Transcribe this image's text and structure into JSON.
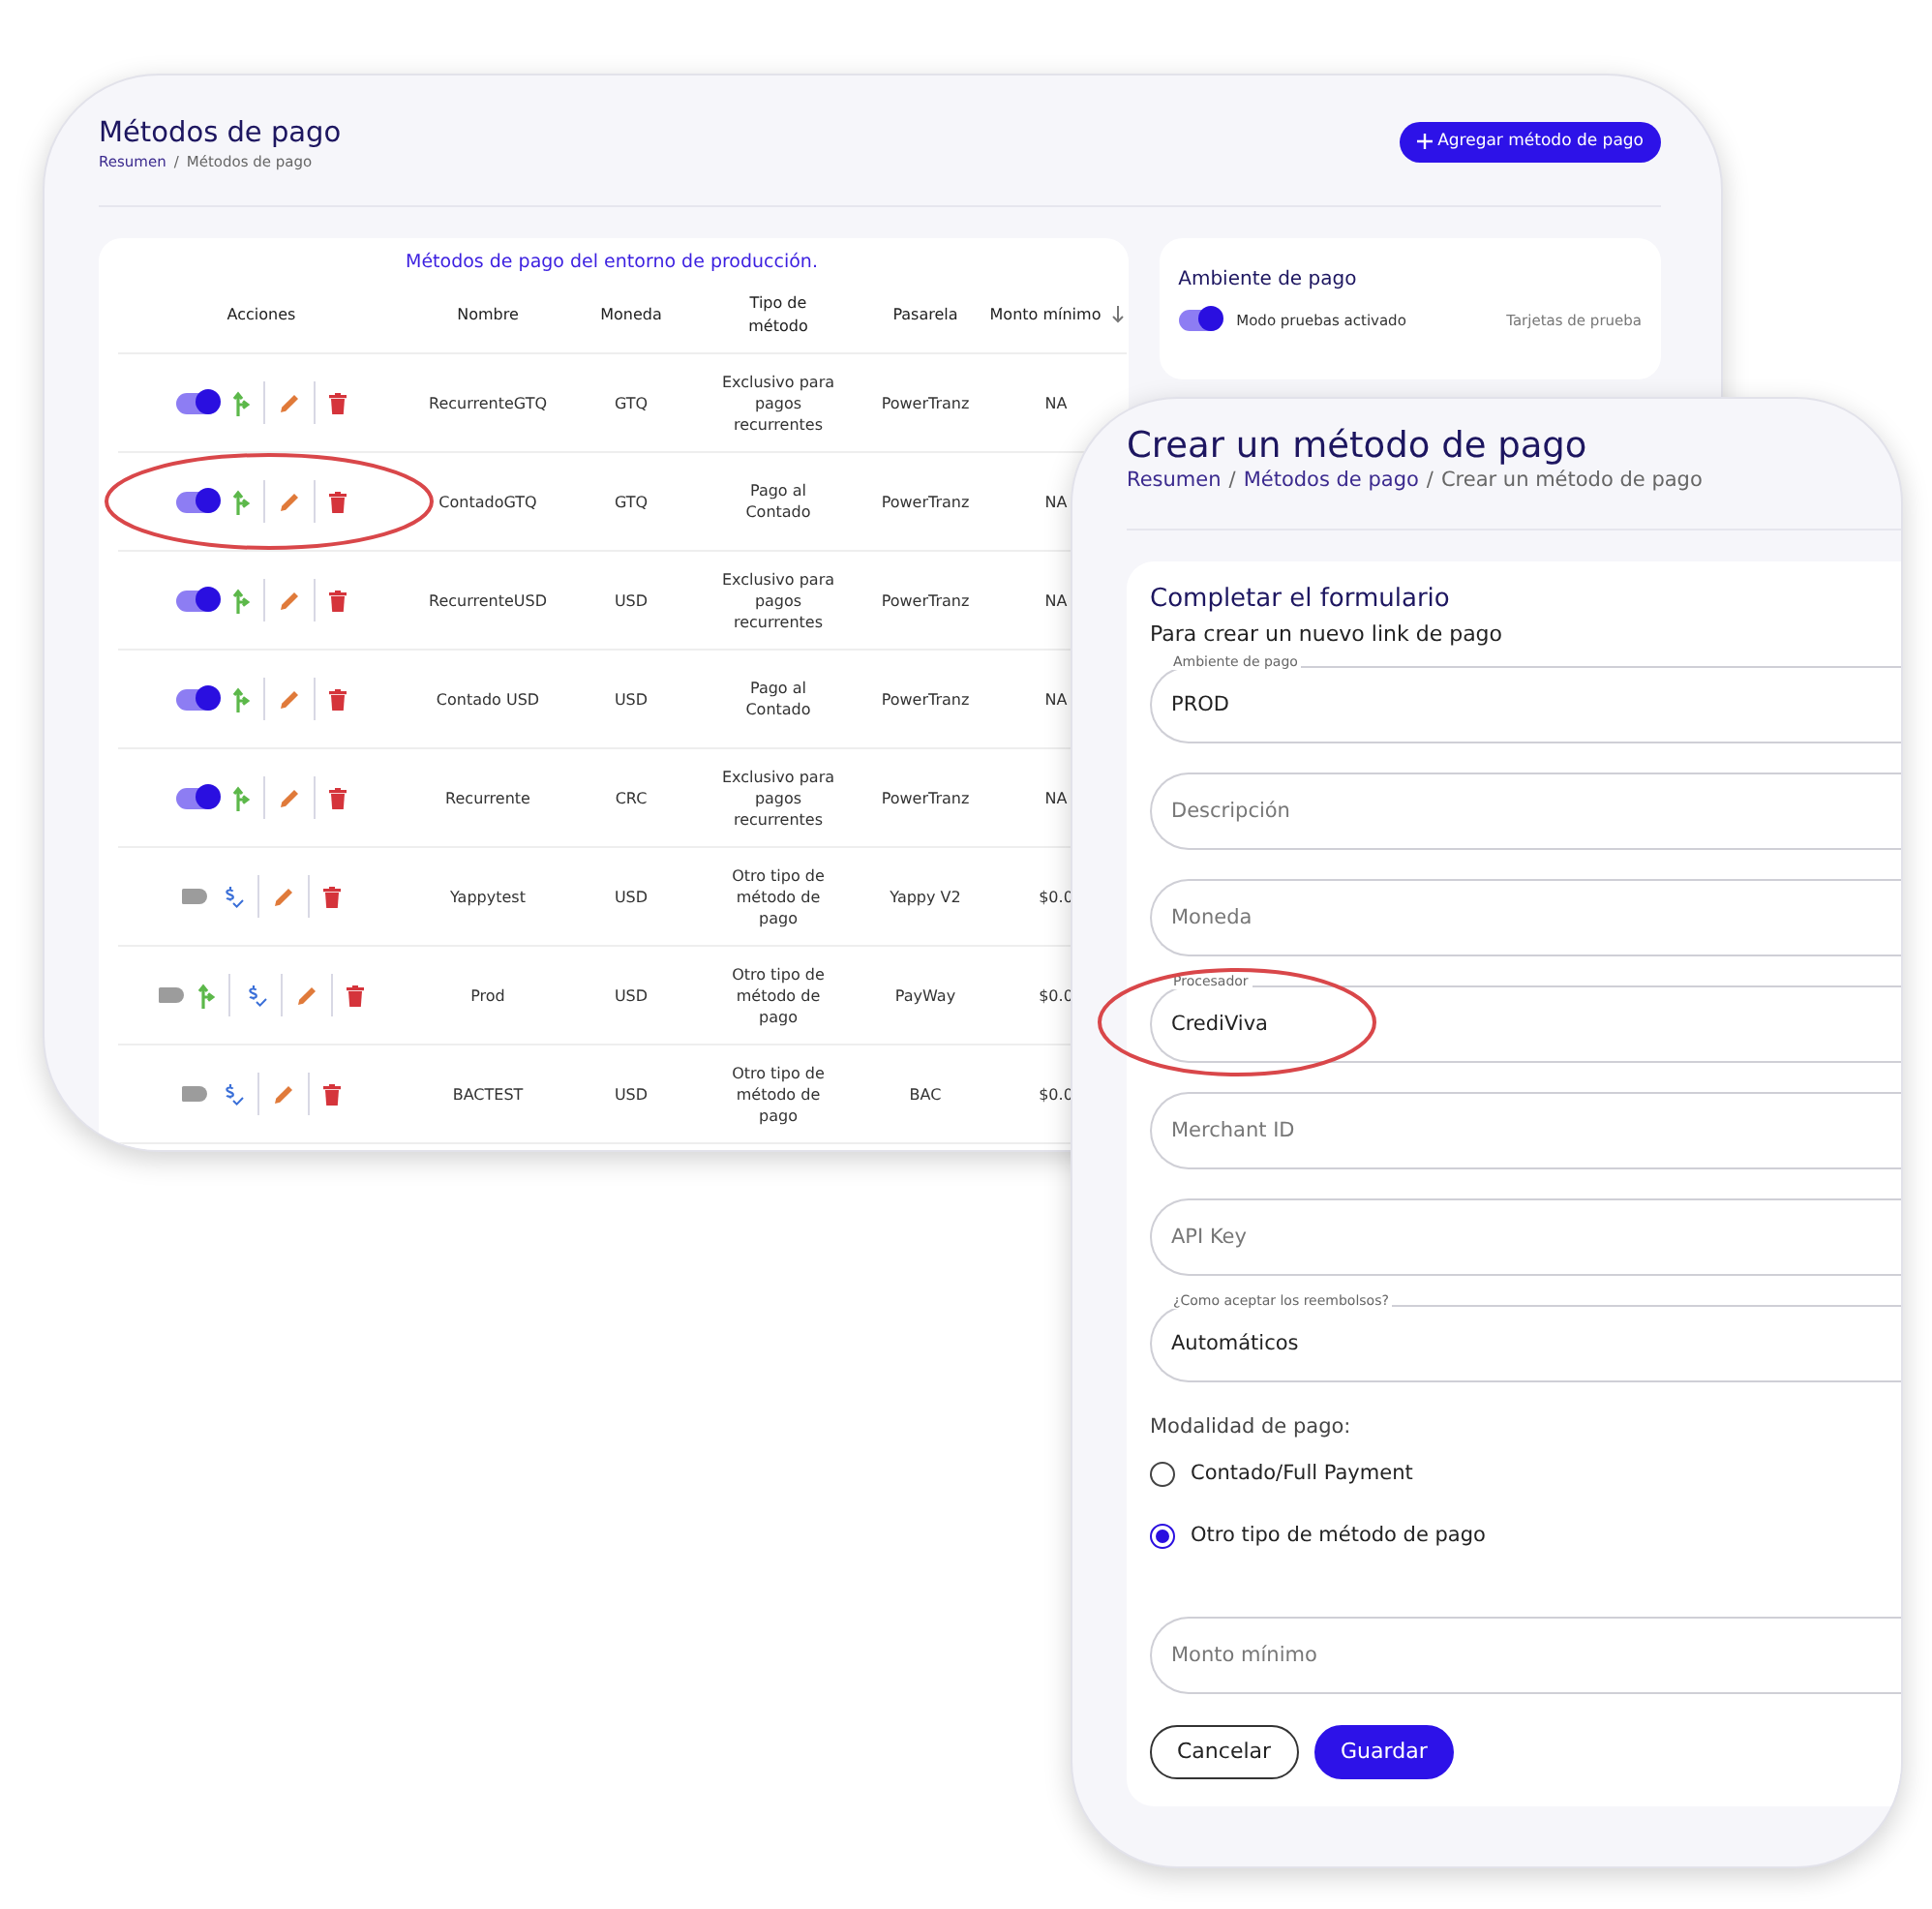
{
  "methods_page": {
    "title": "Métodos de pago",
    "breadcrumb": [
      {
        "label": "Resumen",
        "kind": "link"
      },
      {
        "label": "/",
        "kind": "separator"
      },
      {
        "label": "Métodos de pago",
        "kind": "current"
      }
    ],
    "add_button": "Agregar método de pago"
  },
  "table": {
    "caption": "Métodos de pago del entorno de producción.",
    "actions_column": "Acciones",
    "columns": [
      {
        "label": "Nombre",
        "sorted": false
      },
      {
        "label": "Moneda",
        "sorted": false
      },
      {
        "label": "Tipo de método",
        "sorted": false
      },
      {
        "label": "Pasarela",
        "sorted": false
      },
      {
        "label": "Monto mínimo",
        "sorted": true
      }
    ],
    "rows": [
      {
        "enabled": true,
        "highlighted": false,
        "actions": [
          {
            "kind": "route"
          },
          {
            "kind": "edit"
          },
          {
            "kind": "delete"
          }
        ],
        "cells": [
          "RecurrenteGTQ",
          "GTQ",
          "Exclusivo para pagos recurrentes",
          "PowerTranz",
          "NA"
        ]
      },
      {
        "enabled": true,
        "highlighted": true,
        "actions": [
          {
            "kind": "route"
          },
          {
            "kind": "edit"
          },
          {
            "kind": "delete"
          }
        ],
        "cells": [
          "ContadoGTQ",
          "GTQ",
          "Pago al Contado",
          "PowerTranz",
          "NA"
        ]
      },
      {
        "enabled": true,
        "highlighted": false,
        "actions": [
          {
            "kind": "route"
          },
          {
            "kind": "edit"
          },
          {
            "kind": "delete"
          }
        ],
        "cells": [
          "RecurrenteUSD",
          "USD",
          "Exclusivo para pagos recurrentes",
          "PowerTranz",
          "NA"
        ]
      },
      {
        "enabled": true,
        "highlighted": false,
        "actions": [
          {
            "kind": "route"
          },
          {
            "kind": "edit"
          },
          {
            "kind": "delete"
          }
        ],
        "cells": [
          "Contado USD",
          "USD",
          "Pago al Contado",
          "PowerTranz",
          "NA"
        ]
      },
      {
        "enabled": true,
        "highlighted": false,
        "actions": [
          {
            "kind": "route"
          },
          {
            "kind": "edit"
          },
          {
            "kind": "delete"
          }
        ],
        "cells": [
          "Recurrente",
          "CRC",
          "Exclusivo para pagos recurrentes",
          "PowerTranz",
          "NA"
        ]
      },
      {
        "enabled": false,
        "highlighted": false,
        "actions": [
          {
            "kind": "price"
          },
          {
            "kind": "edit"
          },
          {
            "kind": "delete"
          }
        ],
        "cells": [
          "Yappytest",
          "USD",
          "Otro tipo de método de pago",
          "Yappy V2",
          "$0.0"
        ]
      },
      {
        "enabled": false,
        "highlighted": false,
        "actions": [
          {
            "kind": "route"
          },
          {
            "kind": "price"
          },
          {
            "kind": "edit"
          },
          {
            "kind": "delete"
          }
        ],
        "cells": [
          "Prod",
          "USD",
          "Otro tipo de método de pago",
          "PayWay",
          "$0.0"
        ]
      },
      {
        "enabled": false,
        "highlighted": false,
        "actions": [
          {
            "kind": "price"
          },
          {
            "kind": "edit"
          },
          {
            "kind": "delete"
          }
        ],
        "cells": [
          "BACTEST",
          "USD",
          "Otro tipo de método de pago",
          "BAC",
          "$0.0"
        ]
      }
    ]
  },
  "environment": {
    "title": "Ambiente de pago",
    "test_mode": {
      "label": "Modo pruebas activado",
      "on": true
    },
    "link": "Tarjetas de prueba"
  },
  "form_page": {
    "title": "Crear un método de pago",
    "breadcrumb": [
      {
        "label": "Resumen",
        "kind": "link"
      },
      {
        "label": "/",
        "kind": "separator"
      },
      {
        "label": "Métodos de pago",
        "kind": "link"
      },
      {
        "label": "/",
        "kind": "separator"
      },
      {
        "label": "Crear un método de pago",
        "kind": "current"
      }
    ],
    "card_title": "Completar el formulario",
    "card_subtitle": "Para crear un nuevo link de pago",
    "fields": [
      {
        "label": "Ambiente de pago",
        "value": "PROD",
        "highlighted": false
      },
      {
        "placeholder": "Descripción",
        "highlighted": false
      },
      {
        "placeholder": "Moneda",
        "highlighted": false
      },
      {
        "label": "Procesador",
        "value": "CrediViva",
        "highlighted": true
      },
      {
        "placeholder": "Merchant ID",
        "highlighted": false
      },
      {
        "placeholder": "API Key",
        "highlighted": false
      },
      {
        "label": "¿Como aceptar los reembolsos?",
        "value": "Automáticos",
        "highlighted": false
      }
    ],
    "modality": {
      "label": "Modalidad de pago:",
      "options": [
        {
          "label": "Contado/Full Payment",
          "selected": false
        },
        {
          "label": "Otro tipo de método de pago",
          "selected": true
        }
      ]
    },
    "amount_field": {
      "placeholder": "Monto mínimo"
    },
    "buttons": [
      {
        "label": "Cancelar",
        "kind": "outline"
      },
      {
        "label": "Guardar",
        "kind": "primary"
      }
    ]
  }
}
